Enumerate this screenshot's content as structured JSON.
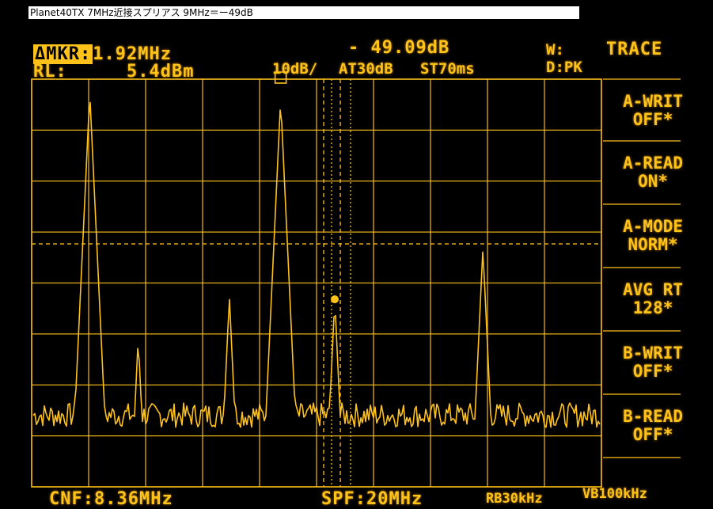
{
  "caption": "Planet40TX  7MHz近接スプリアス  9MHz＝ー49dB",
  "header": {
    "marker_label": "ΔMKR:",
    "marker_freq": "1.92MHz",
    "marker_level": "- 49.09dB",
    "ref_label": "RL:",
    "ref_value": "5.4dBm",
    "scale": "10dB/",
    "attenuation": "AT30dB",
    "sweep_time": "ST70ms",
    "w_label": "W:",
    "d_label": "D:PK"
  },
  "footer": {
    "center_freq": "CNF:8.36MHz",
    "span": "SPF:20MHz",
    "rbw": "RB30kHz",
    "vbw": "VB100kHz"
  },
  "menu": {
    "title": "TRACE",
    "items": [
      {
        "line1": "A-WRIT",
        "line2": "OFF*"
      },
      {
        "line1": "A-READ",
        "line2": "ON*"
      },
      {
        "line1": "A-MODE",
        "line2": "NORM*"
      },
      {
        "line1": "AVG RT",
        "line2": "128*"
      },
      {
        "line1": "B-WRIT",
        "line2": "OFF*"
      },
      {
        "line1": "B-READ",
        "line2": "OFF*"
      }
    ]
  },
  "colors": {
    "trace": "#ffc21a",
    "background": "#000000",
    "caption_bg": "#ffffff"
  },
  "chart_data": {
    "type": "line",
    "title": "",
    "xlabel": "",
    "ylabel": "",
    "xlim": [
      -1.64,
      18.36
    ],
    "ylim": [
      -94.6,
      5.4
    ],
    "grid": true,
    "peaks": [
      {
        "freq_mhz": 0.4,
        "level_dbm": 2.0
      },
      {
        "freq_mhz": 2.1,
        "level_dbm": -58.0
      },
      {
        "freq_mhz": 5.3,
        "level_dbm": -48.0
      },
      {
        "freq_mhz": 7.1,
        "level_dbm": 0.5
      },
      {
        "freq_mhz": 9.0,
        "level_dbm": -48.6
      },
      {
        "freq_mhz": 14.2,
        "level_dbm": -36.0
      }
    ],
    "noise_floor_dbm": -77,
    "display_line_dbm": -35,
    "marker_freq_mhz": 9.0
  }
}
